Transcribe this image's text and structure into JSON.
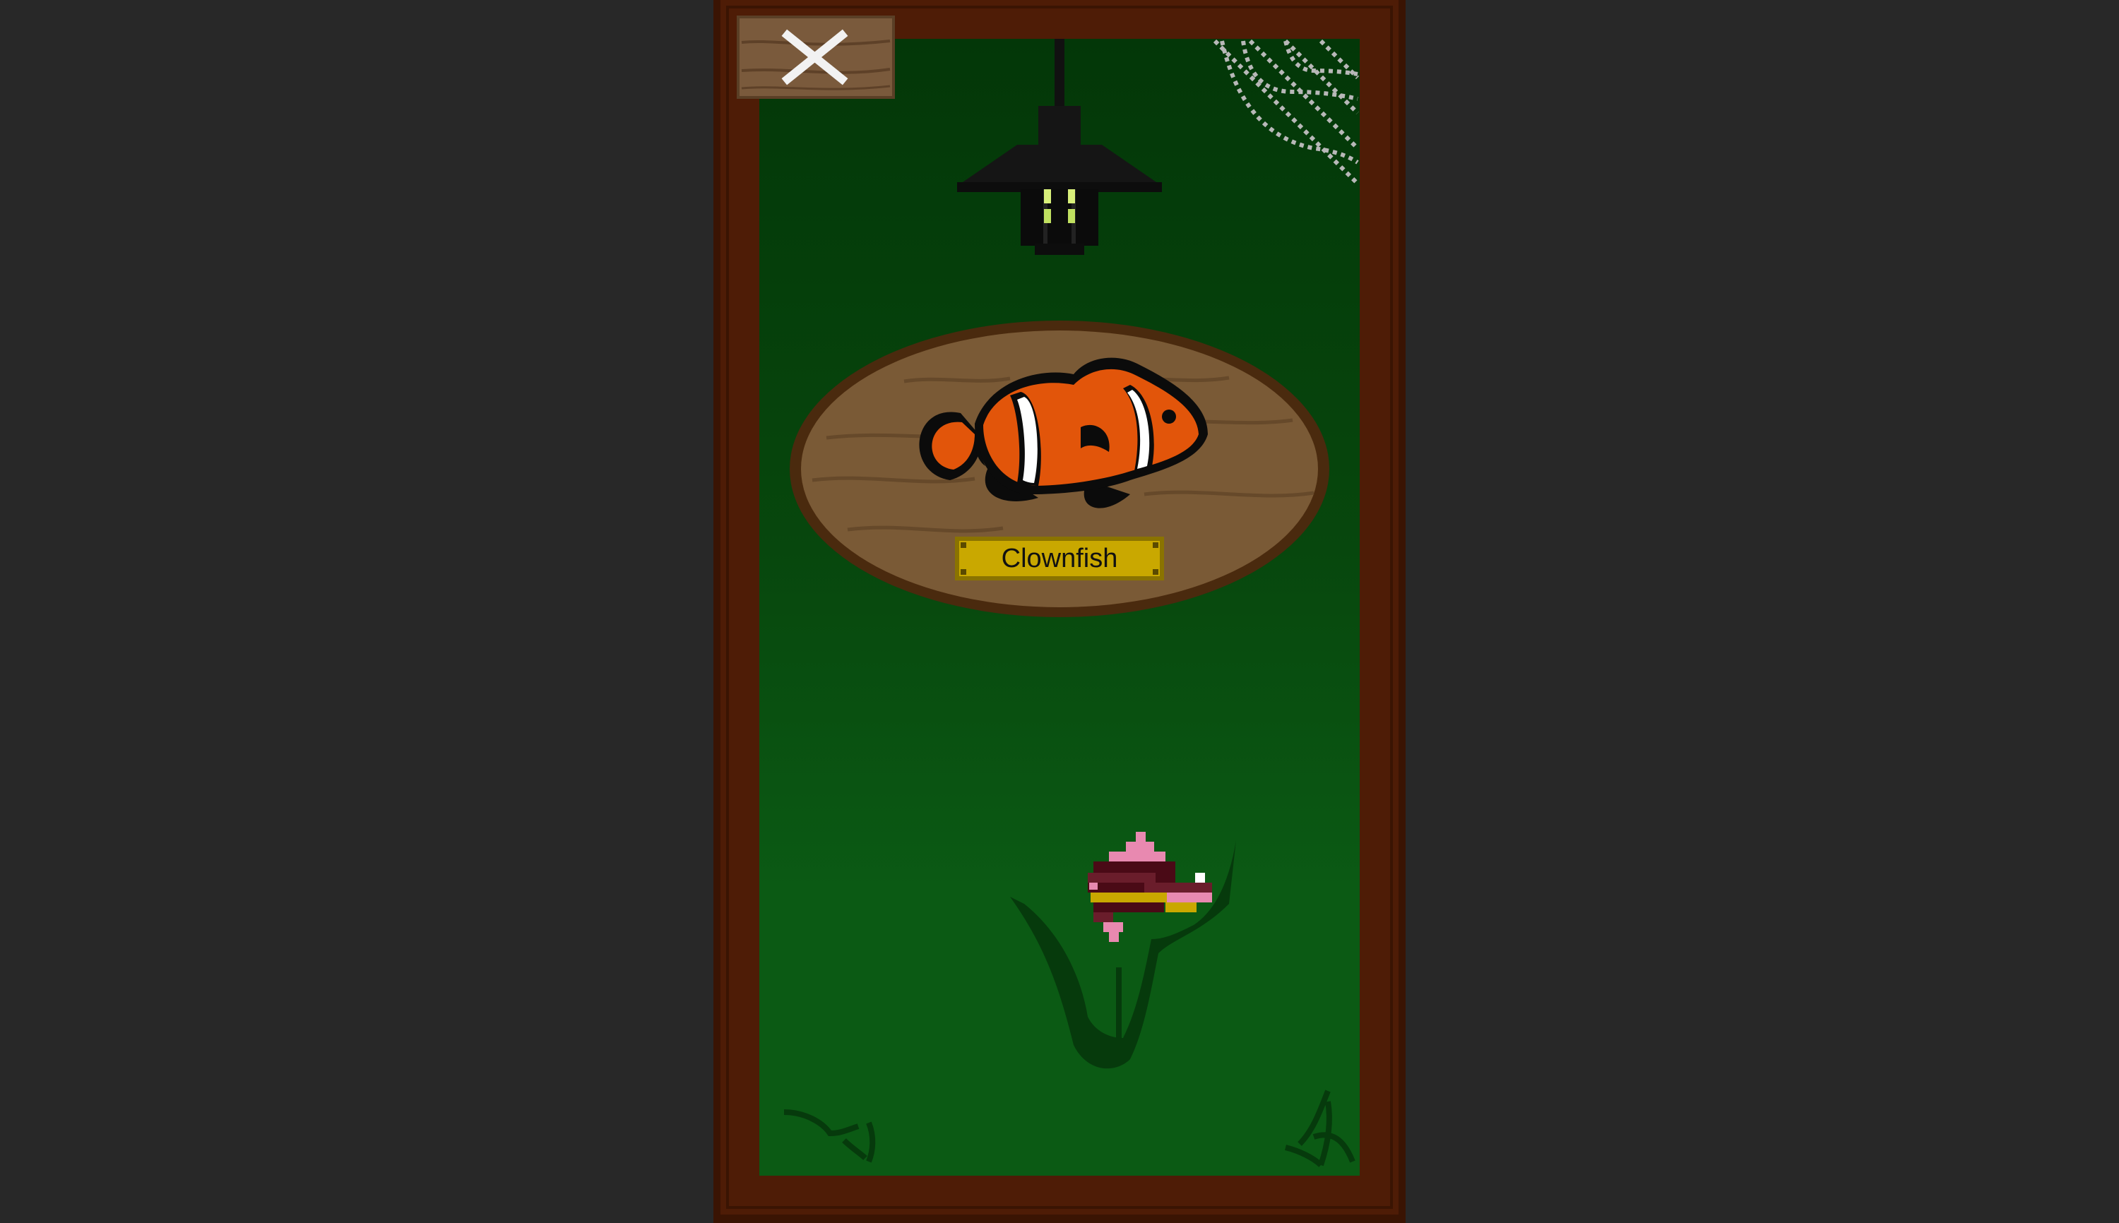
{
  "trophy": {
    "name": "Clownfish"
  },
  "icons": {
    "close": "close-x-icon",
    "lamp": "hanging-lantern",
    "cobweb": "cobweb-corner",
    "pet": "pink-pixel-fish"
  },
  "colors": {
    "page_background": "#282828",
    "frame": "#4e1c06",
    "frame_dark": "#3a1403",
    "wall_green": "#0b5a14",
    "wall_green_top": "#033708",
    "plaque_wood": "#7a5a36",
    "plaque_rim": "#4a2a0e",
    "nameplate_gold": "#c9a800",
    "clownfish_orange": "#e2550a"
  }
}
